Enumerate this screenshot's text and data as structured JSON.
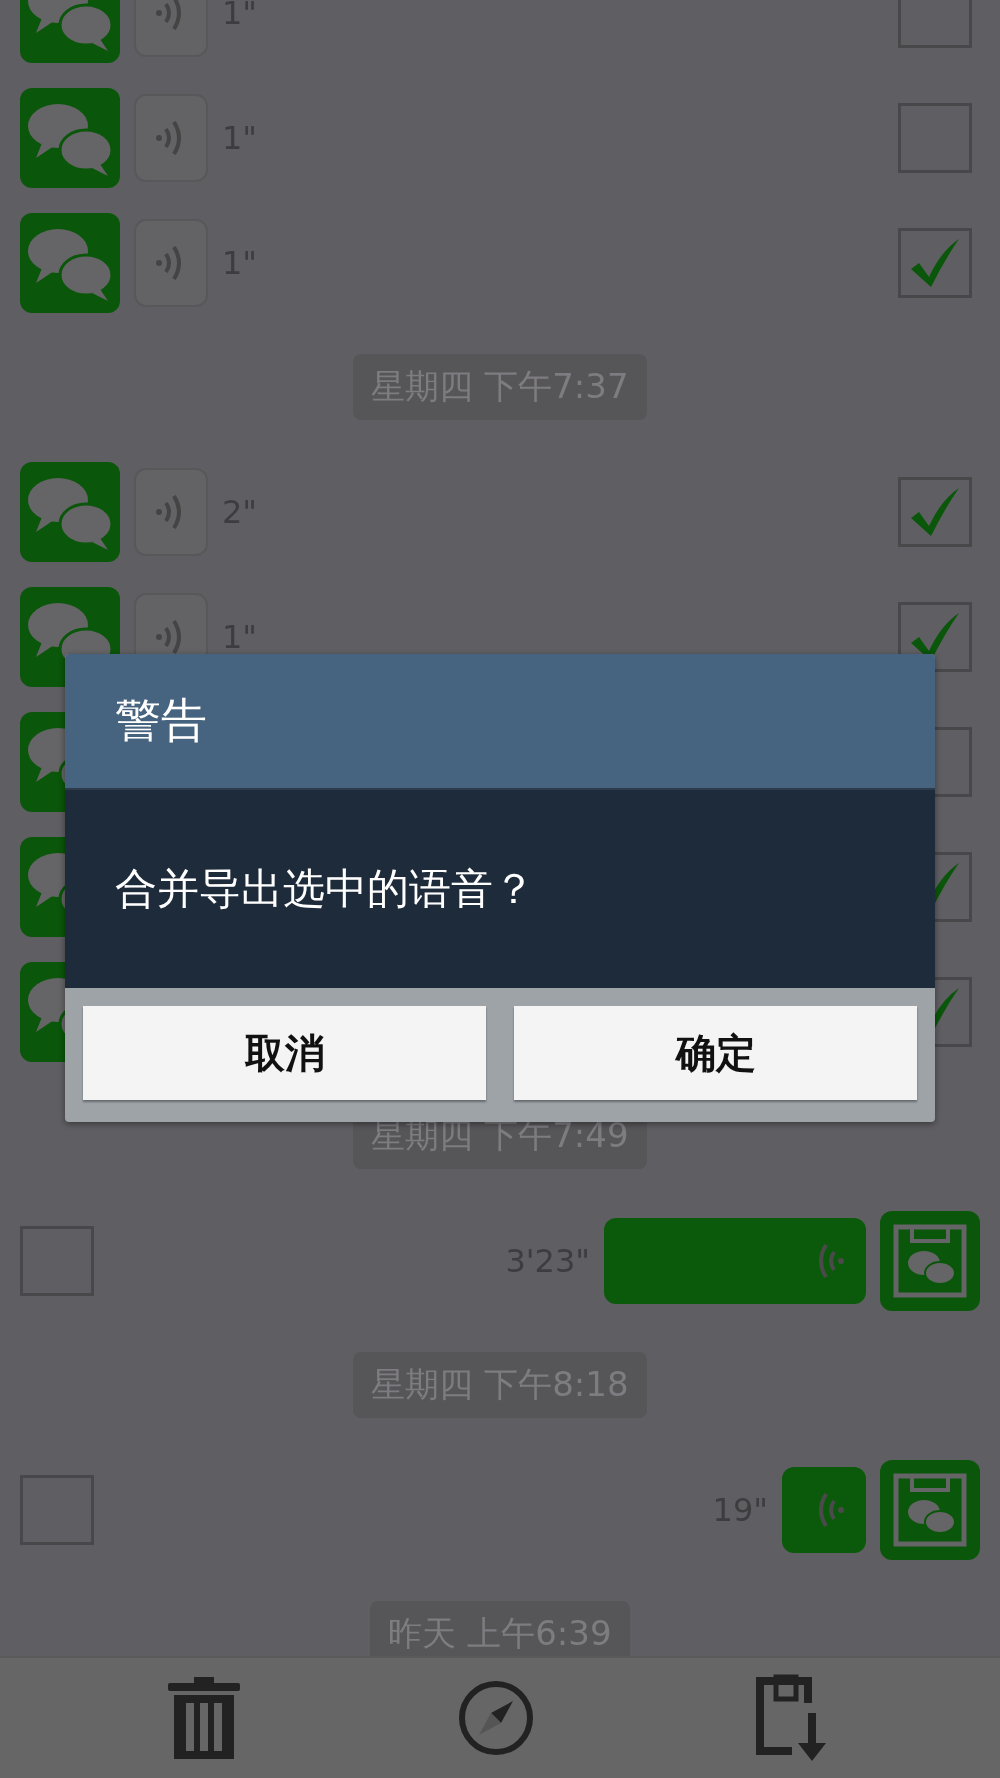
{
  "messages": [
    {
      "kind": "voice_in",
      "duration": "1\"",
      "checked": false
    },
    {
      "kind": "voice_in",
      "duration": "1\"",
      "checked": false
    },
    {
      "kind": "voice_in",
      "duration": "1\"",
      "checked": true
    },
    {
      "kind": "time",
      "text": "星期四 下午7:37"
    },
    {
      "kind": "voice_in",
      "duration": "2\"",
      "checked": true
    },
    {
      "kind": "voice_in",
      "duration": "1\"",
      "checked": true
    },
    {
      "kind": "voice_in",
      "checked": false
    },
    {
      "kind": "voice_in",
      "checked": true
    },
    {
      "kind": "voice_in",
      "checked": true
    },
    {
      "kind": "time",
      "text": "星期四 下午7:49"
    },
    {
      "kind": "voice_out",
      "duration": "3'23\"",
      "checked": false,
      "wide": true
    },
    {
      "kind": "time",
      "text": "星期四 下午8:18"
    },
    {
      "kind": "voice_out",
      "duration": "19\"",
      "checked": false,
      "wide": false
    },
    {
      "kind": "time",
      "text": "昨天 上午6:39"
    }
  ],
  "dialog": {
    "title": "警告",
    "message": "合并导出选中的语音？",
    "buttons": [
      {
        "label": "取消"
      },
      {
        "label": "确定"
      }
    ]
  }
}
